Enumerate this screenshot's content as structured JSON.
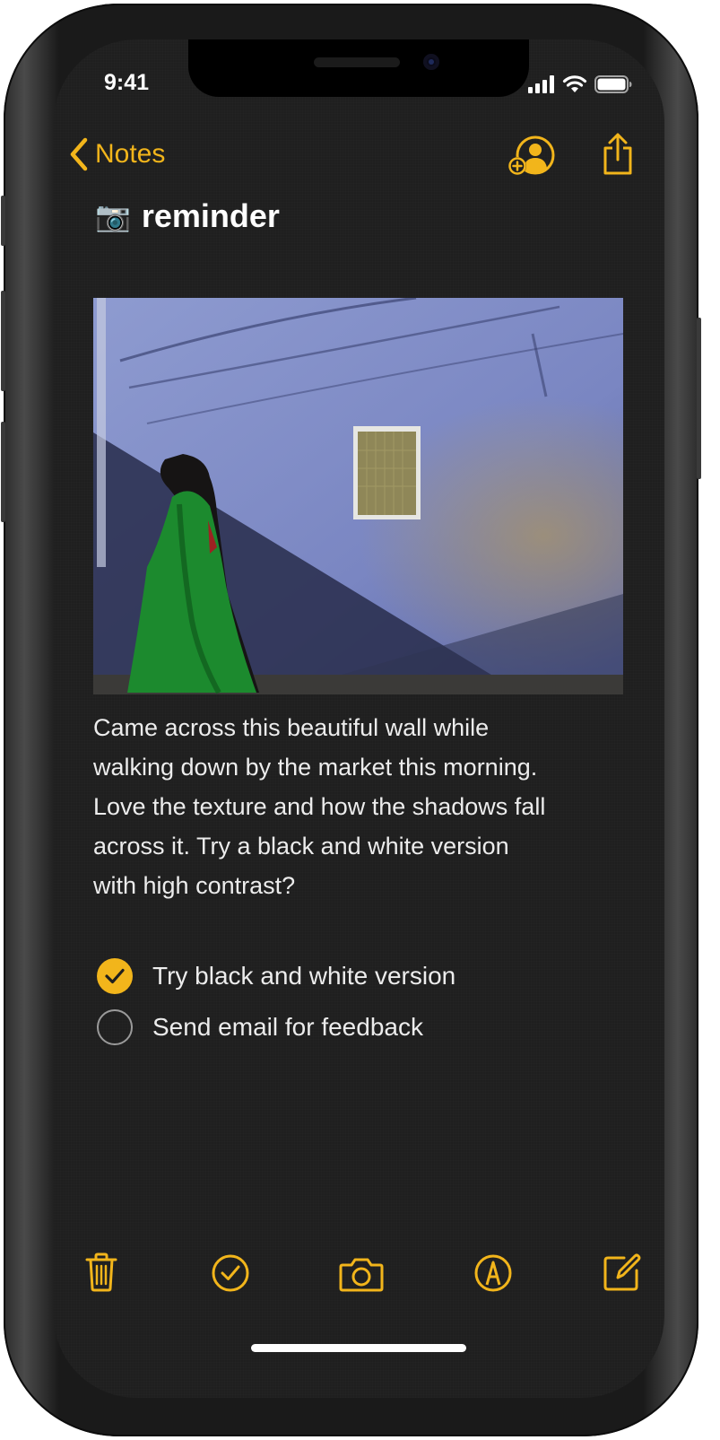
{
  "status_bar": {
    "time": "9:41"
  },
  "nav": {
    "back_label": "Notes"
  },
  "note": {
    "title_emoji": "📷",
    "title": "reminder",
    "body_lines": [
      "Came across this beautiful wall while",
      "walking down by the market this morning.",
      "Love the texture and how the shadows fall",
      "across it. Try a black and white version",
      "with high contrast?"
    ],
    "checklist": [
      {
        "label": "Try black and white version",
        "checked": true
      },
      {
        "label": "Send email for feedback",
        "checked": false
      }
    ]
  },
  "toolbar": {
    "items": [
      "trash-icon",
      "checklist-icon",
      "camera-icon",
      "markup-icon",
      "compose-icon"
    ]
  },
  "colors": {
    "accent": "#f2b51b",
    "background": "#1f1f1f",
    "text": "#ececec"
  }
}
